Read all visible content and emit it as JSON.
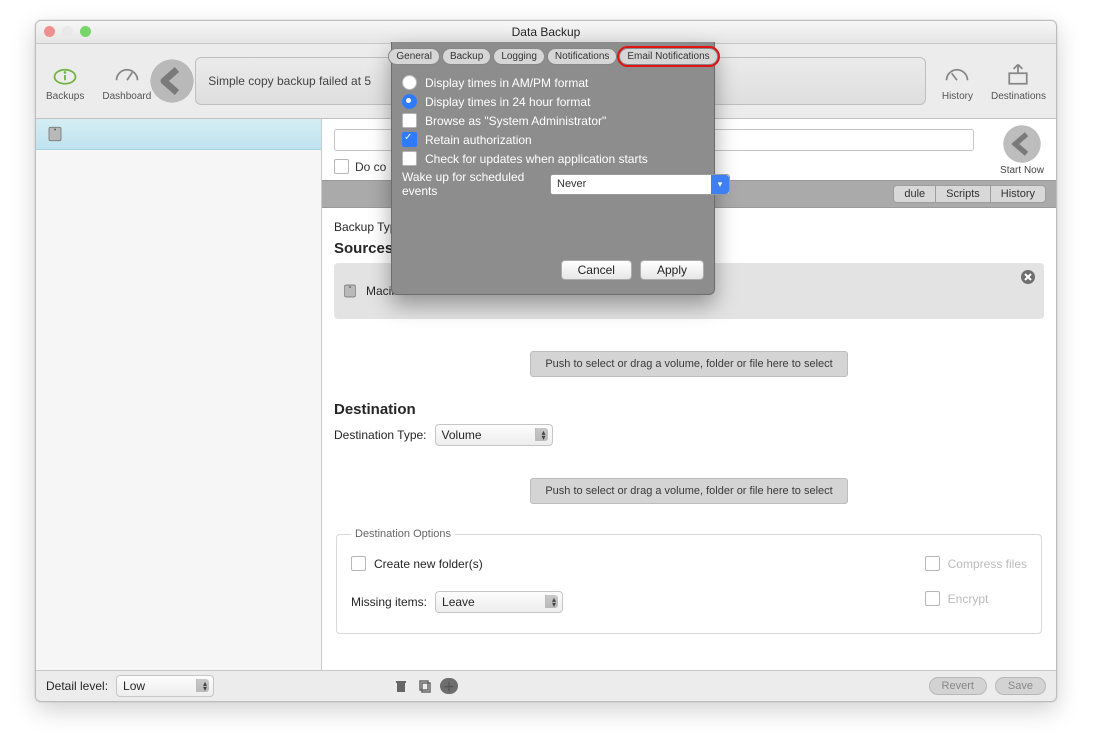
{
  "window": {
    "title": "Data Backup"
  },
  "toolbar": {
    "left": [
      {
        "key": "backups",
        "label": "Backups"
      },
      {
        "key": "dashboard",
        "label": "Dashboard"
      }
    ],
    "status_text": "Simple copy backup failed at 5",
    "right": [
      {
        "key": "history",
        "label": "History"
      },
      {
        "key": "destinations",
        "label": "Destinations"
      }
    ]
  },
  "sidebar": {
    "items": [
      {
        "label": ""
      }
    ]
  },
  "main": {
    "name_input_value": "",
    "do_not_auto_label": "Do co",
    "start_now_label": "Start Now",
    "segments": [
      "dule",
      "Scripts",
      "History"
    ],
    "backup_type_label": "Backup Typ",
    "sources_heading": "Sources",
    "source_item": "Macintosh HD",
    "drop_hint": "Push to select or drag a volume, folder or file here to select",
    "destination_heading": "Destination",
    "dest_type_label": "Destination Type:",
    "dest_type_value": "Volume",
    "dest_options_legend": "Destination Options",
    "create_folders_label": "Create new folder(s)",
    "compress_label": "Compress files",
    "encrypt_label": "Encrypt",
    "missing_items_label": "Missing items:",
    "missing_items_value": "Leave"
  },
  "footer": {
    "detail_label": "Detail level:",
    "detail_value": "Low",
    "revert": "Revert",
    "save": "Save"
  },
  "sheet": {
    "tabs": [
      "General",
      "Backup",
      "Logging",
      "Notifications",
      "Email Notifications"
    ],
    "highlight_tab_index": 4,
    "ampm_label": "Display times in AM/PM format",
    "hour24_label": "Display times in 24 hour format",
    "selected_time_format": "24",
    "browse_admin_label": "Browse as \"System Administrator\"",
    "browse_admin_checked": false,
    "retain_auth_label": "Retain authorization",
    "retain_auth_checked": true,
    "check_updates_label": "Check for updates when application starts",
    "check_updates_checked": false,
    "wake_label": "Wake up for scheduled events",
    "wake_value": "Never",
    "cancel": "Cancel",
    "apply": "Apply"
  }
}
